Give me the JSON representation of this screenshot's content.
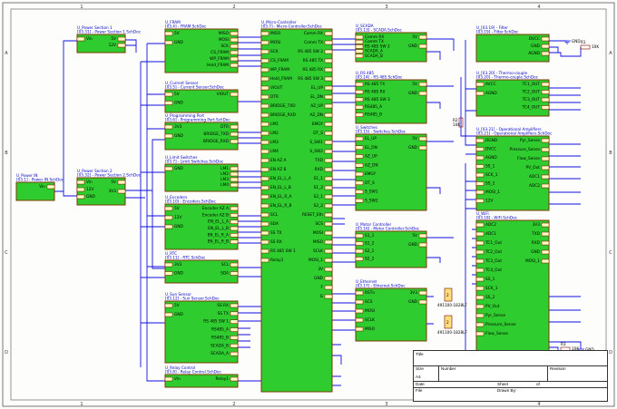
{
  "frame": {
    "cols": [
      "1",
      "2",
      "3",
      "4"
    ],
    "rows": [
      "A",
      "B",
      "C",
      "D"
    ]
  },
  "blocks": [
    {
      "id": "ps1",
      "des": "U_Power Section 1",
      "file": "[03.31] - Power Section 1.SchDoc",
      "left": [
        "Vin"
      ],
      "right": [
        "5V",
        "12V"
      ]
    },
    {
      "id": "ps2",
      "des": "U_Power Section 2",
      "file": "[03.32] - Power Section 2.SchDoc",
      "left": [
        "Vin",
        "12V",
        "GND"
      ],
      "right": [
        "5V",
        "3V3"
      ]
    },
    {
      "id": "pin",
      "des": "U_Power IN",
      "file": "[03.1] - Power IN.SchDoc",
      "left": [],
      "right": [
        "Vin"
      ]
    },
    {
      "id": "fram",
      "des": "U_FRAM",
      "file": "[03.4] - FRAM.SchDoc",
      "left": [
        "5V",
        "GND"
      ],
      "right": [
        "MISO",
        "MOSI",
        "SCK",
        "CS_FRAM",
        "WP_FRAM",
        "Hold_FRAM"
      ]
    },
    {
      "id": "cur",
      "des": "U_Current Sensor",
      "file": "[03.5] - Current Sensor.SchDoc",
      "left": [
        "5V",
        "GND"
      ],
      "right": [
        "VIOUT"
      ]
    },
    {
      "id": "prog",
      "des": "U_Programming Port",
      "file": "[03.6] - Programming Port.SchDoc",
      "left": [
        "3V3",
        "GND"
      ],
      "right": [
        "DTR",
        "BRIDGE_TXD",
        "BRIDGE_RXD"
      ]
    },
    {
      "id": "lim",
      "des": "U_Limit Switches",
      "file": "[03.7] - Limit Switches.SchDoc",
      "left": [
        "GND"
      ],
      "right": [
        "LM1",
        "LM2",
        "LM3",
        "LM4"
      ]
    },
    {
      "id": "enc",
      "des": "U_Encoders",
      "file": "[03.10] - Encoders.SchDoc",
      "left": [
        "5V",
        "12V",
        "GND"
      ],
      "right": [
        "Encoder AZ A",
        "Encoder AZ B",
        "EN_EL_L_A",
        "EN_EL_L_B",
        "EN_EL_R_A",
        "EN_EL_R_B"
      ]
    },
    {
      "id": "rtc",
      "des": "U_RTC",
      "file": "[03.11] - RTC.SchDoc",
      "left": [
        "3V3",
        "GND"
      ],
      "right": [
        "SCL",
        "SDA"
      ]
    },
    {
      "id": "sun",
      "des": "U_Sun Sensor",
      "file": "[03.12] - Sun Sensor.SchDoc",
      "left": [
        "5V",
        "GND"
      ],
      "right": [
        "SS RX",
        "SS TX",
        "RS 485 SW 1",
        "RS485_A",
        "RS485_B",
        "SCADA_B",
        "SCADA_A"
      ]
    },
    {
      "id": "relay",
      "des": "U_Relay Control",
      "file": "[03.8] - Relay Control.SchDoc",
      "left": [
        "Vin"
      ],
      "right": [
        "Relay1"
      ]
    },
    {
      "id": "mcu",
      "des": "U_Micro-Controller",
      "file": "[03.7] - Micro-Controller.SchDoc",
      "left": [
        "MISO",
        "MOSI",
        "SCK",
        "CS_FRAM",
        "WP_FRAM",
        "Hold_FRAM",
        "VIOUT",
        "DTR",
        "BRIDGE_TXD",
        "BRIDGE_RXD",
        "LM1",
        "LM2",
        "LM3",
        "LM4",
        "EN AZ A",
        "EN AZ B",
        "EN_EL_L_A",
        "EN_EL_L_B",
        "EN_EL_R_A",
        "EN_EL_R_B",
        "SCL",
        "SDA",
        "SS TX",
        "SS RX",
        "RS 485 SW 1",
        "Relay1"
      ],
      "right": [
        "Comm RX",
        "Comm TX",
        "RS 485 SW 2",
        "RS 485 TX",
        "RS 485 RX",
        "RS 485 SW 3",
        "EL_UP",
        "EL_DN",
        "AZ_UP",
        "AZ_DN",
        "EMGY",
        "DT_S",
        "S_SW1",
        "S_SW2",
        "TXD",
        "RXD",
        "S1_1",
        "S1_2",
        "S2_1",
        "S2_2",
        "RESET_Eth",
        "SCS",
        "MOSI",
        "MISO",
        "SCLK",
        "MOSI_1",
        "3V",
        "GND",
        "F",
        "G"
      ]
    },
    {
      "id": "scada",
      "des": "U_SCADA",
      "file": "[03.13] - SCADA.SchDoc",
      "left": [
        "Comm RX",
        "Comm TX",
        "RS 485 SW 2",
        "SCADA_A",
        "SCADA_B"
      ],
      "right": [
        "5V",
        "GND"
      ]
    },
    {
      "id": "rs485",
      "des": "U_RS 485",
      "file": "[03.14] - RS 485.SchDoc",
      "left": [
        "RS 485 TX",
        "RS 485 RX",
        "RS 485 SW 3",
        "RS485_A",
        "RS485_B"
      ],
      "right": [
        "5V",
        "GND"
      ]
    },
    {
      "id": "sw",
      "des": "U_Switches",
      "file": "[03.15] - Switches.SchDoc",
      "left": [
        "EL_UP",
        "EL_DN",
        "AZ_UP",
        "AZ_DN",
        "EMGY",
        "DT_S",
        "S_SW1",
        "S_SW2"
      ],
      "right": [
        "5V",
        "GND"
      ]
    },
    {
      "id": "motor",
      "des": "U_Motor Controller",
      "file": "[03.16] - Motor Controller.SchDoc",
      "left": [
        "S1_1",
        "S1_2",
        "S2_1",
        "S2_2"
      ],
      "right": [
        "5V",
        "GND"
      ]
    },
    {
      "id": "eth",
      "des": "U_Ethernet",
      "file": "[03.17] - Ethernet.SchDoc",
      "left": [
        "RSTn",
        "SCS",
        "MOSI",
        "SCLK",
        "MISO"
      ],
      "right": [
        "3V3",
        "GND"
      ]
    },
    {
      "id": "filter",
      "des": "U_[03.19] - Filter",
      "file": "[03.19] - Filter.SchDoc",
      "left": [],
      "right": [
        "DVCC",
        "GND",
        "AGND"
      ]
    },
    {
      "id": "thermo",
      "des": "U_[03.20] - Thermo-couple",
      "file": "[03.20] - Thermo-couple.SchDoc",
      "left": [
        "AVCC",
        "AGND"
      ],
      "right": [
        "TC1_OUT",
        "TC2_OUT",
        "TC3_OUT",
        "TC4_OUT"
      ]
    },
    {
      "id": "opamp",
      "des": "U_[03.21] - Operational Amplifiers",
      "file": "[03.21] - Operational Amplifiers.SchDoc",
      "left": [
        "DGND",
        "DVCC",
        "AGND",
        "SS_1",
        "SCK_1",
        "SS_2",
        "MOSI_1",
        "12V"
      ],
      "right": [
        "Pyr_Sense",
        "Pressure_Sense",
        "Flow_Sense",
        "PV_Out",
        "ADC1",
        "ADC2"
      ]
    },
    {
      "id": "wifi",
      "des": "U_WiFi",
      "file": "[03.18] - WiFi.SchDoc",
      "left": [
        "ADC2",
        "ADC1",
        "TC1_Out",
        "TC2_Out",
        "TC3_Out",
        "TC4_Out",
        "SS_1",
        "SCK_1",
        "SS_2",
        "PV_Out",
        "Pyr_Sense",
        "Pressure_Sense",
        "Flow_Sense"
      ],
      "right": [
        "3V3",
        "TXD",
        "RXD",
        "GND",
        "MOSI_1"
      ]
    }
  ],
  "parts": {
    "conn1": "491100-1828LF",
    "conn2": "491100-1828LF",
    "r1": "R1",
    "r1_val": "10K",
    "r2": "R2",
    "r2_val": "10K",
    "r3": "R3",
    "r3_val": "10K",
    "gnd": "GND"
  },
  "title_block": {
    "title": "Title",
    "size": "Size",
    "size_val": "A4",
    "number": "Number",
    "revision": "Revision",
    "date": "Date",
    "file": "File",
    "sheet": "Sheet",
    "of": "of",
    "drawn_by": "Drawn By:"
  }
}
